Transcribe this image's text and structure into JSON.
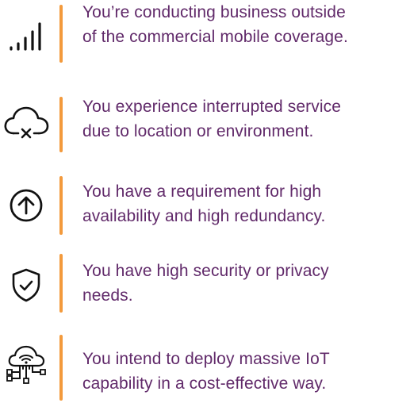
{
  "accent_color": "#f39a3c",
  "text_color": "#612a6a",
  "icon_color": "#111111",
  "items": [
    {
      "icon": "signal-bars-icon",
      "lines": [
        "You’re conducting business outside",
        "of the commercial mobile coverage."
      ]
    },
    {
      "icon": "cloud-offline-icon",
      "lines": [
        "You experience interrupted service",
        "due to location or environment."
      ]
    },
    {
      "icon": "arrow-up-circle-icon",
      "lines": [
        "You have a requirement for high",
        "availability and high redundancy."
      ]
    },
    {
      "icon": "shield-check-icon",
      "lines": [
        "You have high security or privacy",
        "needs."
      ]
    },
    {
      "icon": "iot-cloud-network-icon",
      "lines": [
        "You intend to deploy massive IoT",
        "capability in a cost-effective way."
      ]
    }
  ]
}
